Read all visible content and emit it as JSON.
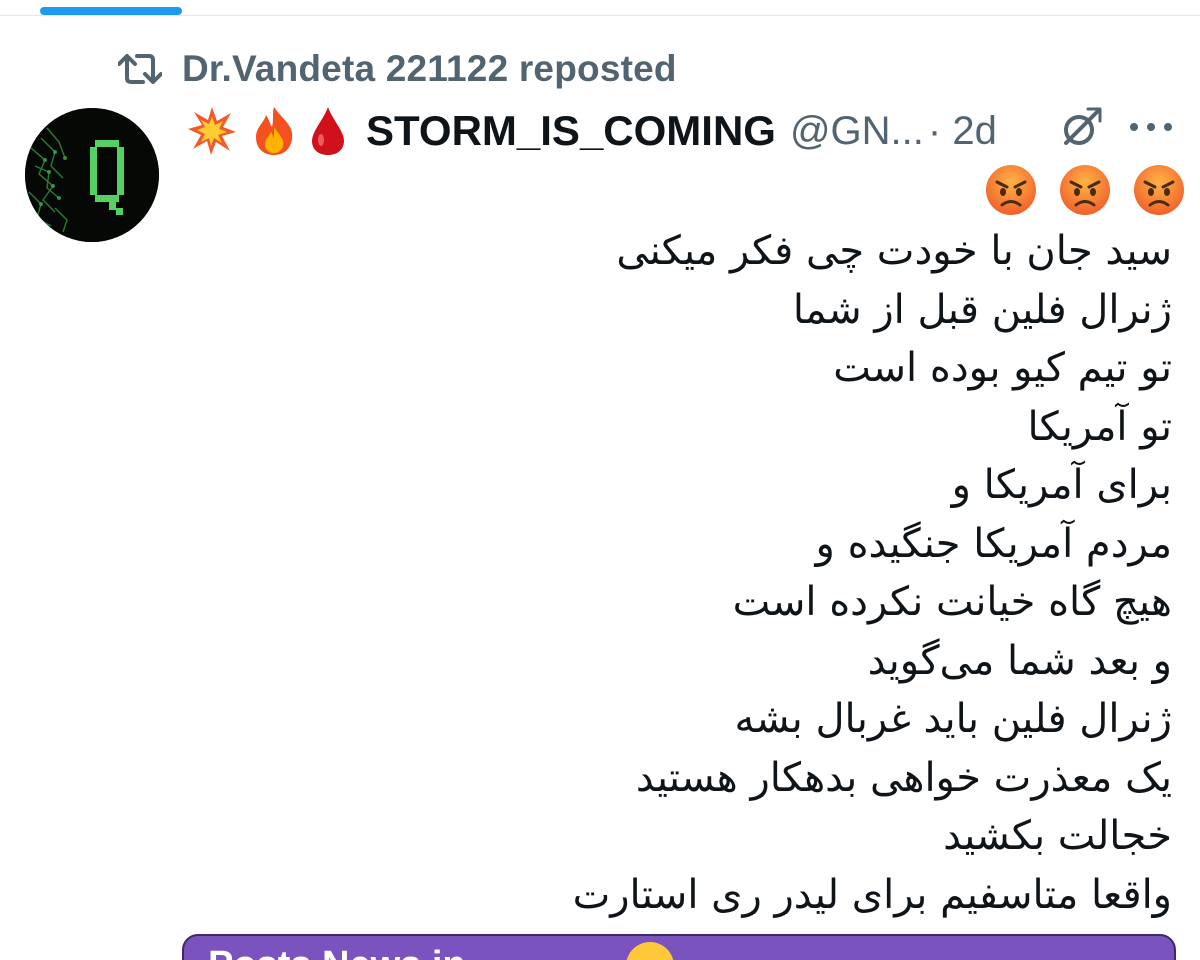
{
  "repost": {
    "icon": "repost-icon",
    "text": "Dr.Vandeta 221122 reposted"
  },
  "author": {
    "avatar": "avatar",
    "emojis": [
      "collision-emoji",
      "fire-emoji",
      "drop-of-blood-emoji"
    ],
    "display_name": "STORM_IS_COMING",
    "handle": "@GN...",
    "time": "· 2d"
  },
  "actions": {
    "grok_icon": "grok-icon",
    "more_icon": "more-icon"
  },
  "tweet": {
    "reaction_emojis": [
      "angry-face-emoji",
      "angry-face-emoji",
      "angry-face-emoji"
    ],
    "lines": [
      "سید جان با خودت چی فکر میکنی",
      "ژنرال فلین قبل از شما",
      "تو تیم کیو بوده است",
      "تو آمریکا",
      "برای آمریکا و",
      "مردم آمریکا جنگیده  و",
      "هیچ گاه خیانت نکرده است",
      "و بعد شما می‌گوید",
      "ژنرال فلین باید غربال بشه",
      "یک معذرت خواهی بدهکار هستید",
      "خجالت بکشید",
      "واقعا متاسفیم برای لیدر ری استارت"
    ]
  },
  "card": {
    "text": "Posts News in ...",
    "background_color": "#7b53bf"
  },
  "colors": {
    "accent": "#1d9bf0",
    "secondary_text": "#536471",
    "primary_text": "#0f1419"
  }
}
